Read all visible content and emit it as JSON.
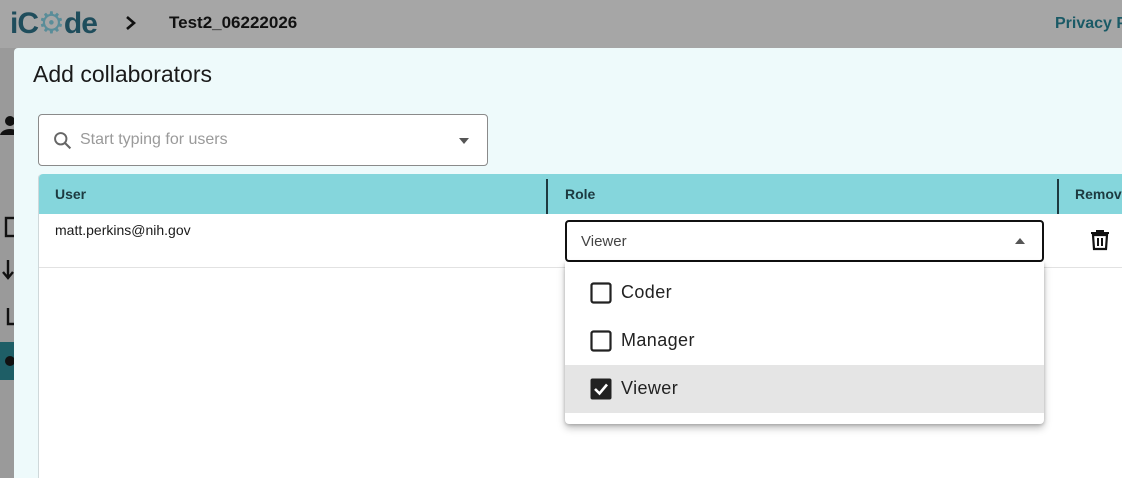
{
  "app": {
    "logo_text_prefix": "iC",
    "logo_text_suffix": "de",
    "breadcrumb_title": "Test2_06222026",
    "privacy_link": "Privacy P"
  },
  "dialog": {
    "title": "Add collaborators",
    "search": {
      "placeholder": "Start typing for users",
      "value": ""
    },
    "table": {
      "columns": [
        "User",
        "Role",
        "Remov"
      ],
      "rows": [
        {
          "user": "matt.perkins@nih.gov",
          "role": "Viewer"
        }
      ]
    },
    "role_menu": {
      "options": [
        {
          "label": "Coder",
          "checked": false
        },
        {
          "label": "Manager",
          "checked": false
        },
        {
          "label": "Viewer",
          "checked": true
        }
      ]
    }
  },
  "colors": {
    "header_teal": "#85d6dc",
    "dialog_bg": "#eefafb",
    "brand_dark": "#1f4d5c"
  }
}
